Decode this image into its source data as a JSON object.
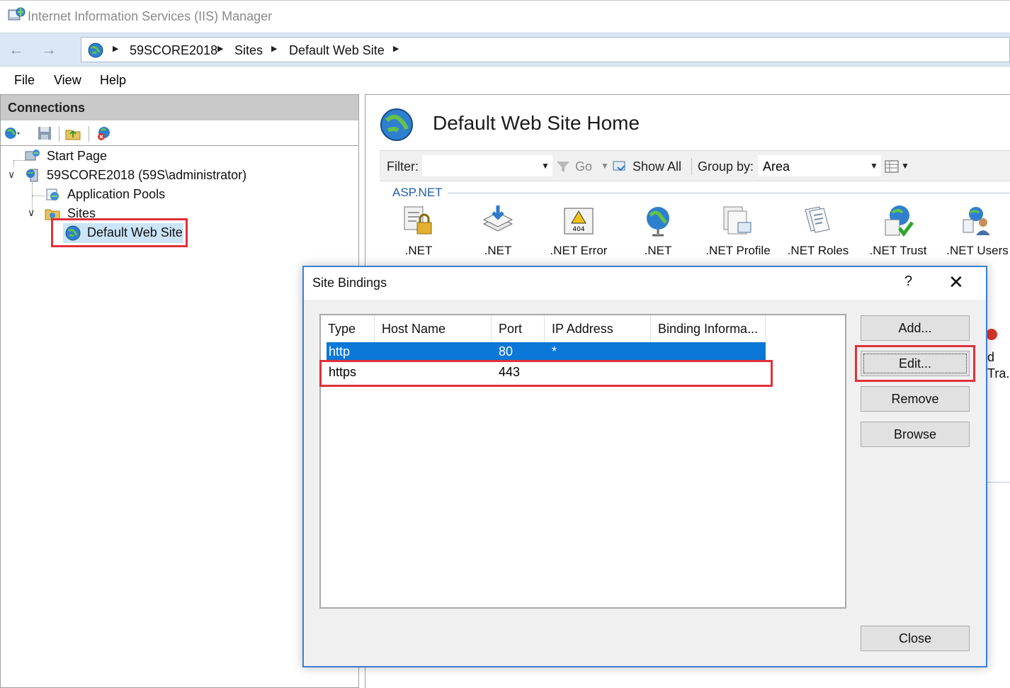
{
  "window": {
    "title": "Internet Information Services (IIS) Manager"
  },
  "address": {
    "breadcrumbs": [
      "59SCORE2018",
      "Sites",
      "Default Web Site"
    ]
  },
  "menu": {
    "items": [
      "File",
      "View",
      "Help"
    ]
  },
  "connections": {
    "header": "Connections",
    "tree": {
      "start_page": "Start Page",
      "server": "59SCORE2018 (59S\\administrator)",
      "app_pools": "Application Pools",
      "sites": "Sites",
      "default_site": "Default Web Site"
    }
  },
  "main": {
    "title": "Default Web Site Home",
    "filter_label": "Filter:",
    "go_label": "Go",
    "show_all_label": "Show All",
    "group_by_label": "Group by:",
    "group_by_value": "Area",
    "section": "ASP.NET",
    "features": [
      ".NET",
      ".NET",
      ".NET Error",
      ".NET",
      ".NET Profile",
      ".NET Roles",
      ".NET Trust",
      ".NET Users"
    ],
    "peek_text": [
      "d",
      "Tra.."
    ]
  },
  "dialog": {
    "title": "Site Bindings",
    "help_glyph": "?",
    "close_glyph": "✕",
    "columns": [
      "Type",
      "Host Name",
      "Port",
      "IP Address",
      "Binding Informa..."
    ],
    "rows": [
      {
        "type": "http",
        "host": "",
        "port": "80",
        "ip": "*",
        "info": ""
      },
      {
        "type": "https",
        "host": "",
        "port": "443",
        "ip": "",
        "info": ""
      }
    ],
    "buttons": {
      "add": "Add...",
      "edit": "Edit...",
      "remove": "Remove",
      "browse": "Browse",
      "close": "Close"
    }
  },
  "colors": {
    "selection": "#0b78d7",
    "highlight_box": "#e0313b",
    "dialog_border": "#3a7fd6",
    "section_title": "#1f5fa8"
  }
}
